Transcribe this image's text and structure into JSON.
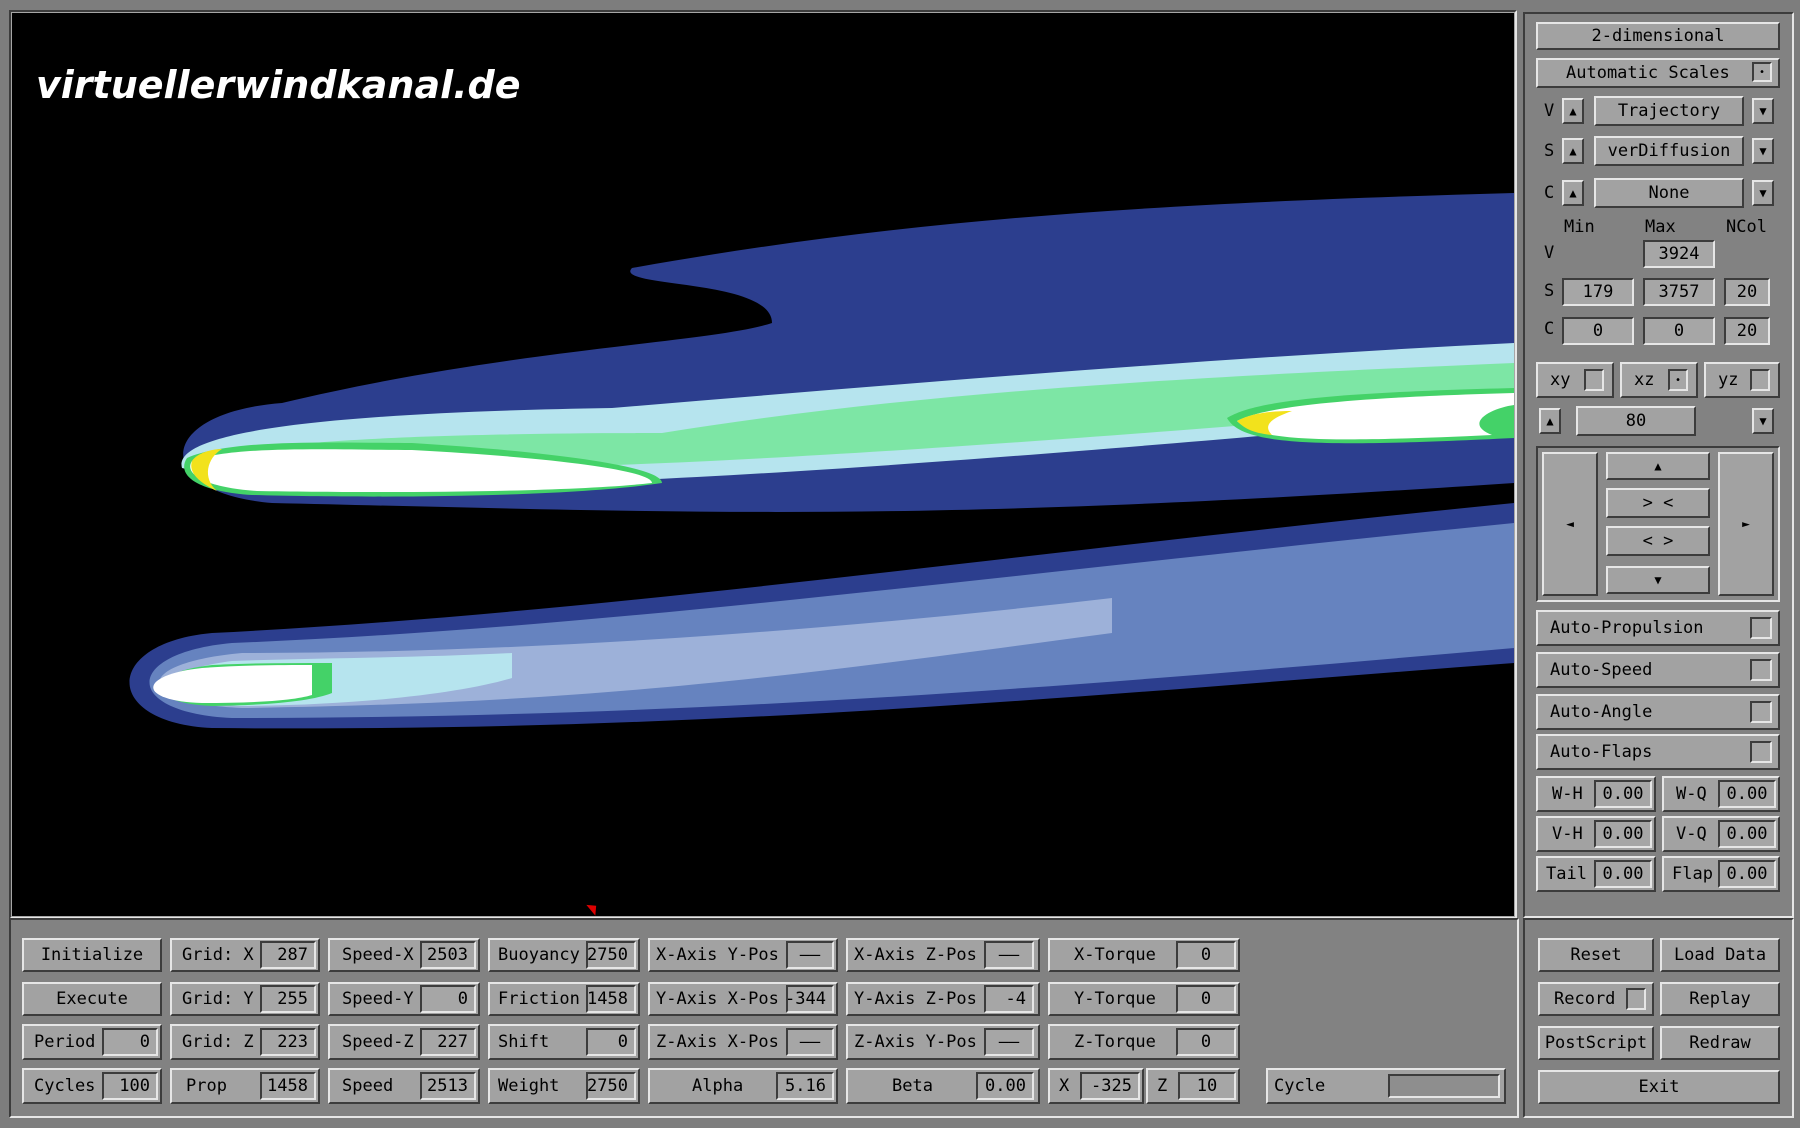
{
  "watermark": "virtuellerwindkanal.de",
  "right_panel": {
    "mode_button": "2-dimensional",
    "auto_scales": "Automatic Scales",
    "v_label": "V",
    "v_value": "Trajectory",
    "s_label": "S",
    "s_value": "verDiffusion",
    "c_label": "C",
    "c_value": "None",
    "col_min": "Min",
    "col_max": "Max",
    "col_ncol": "NCol",
    "v_row_label": "V",
    "v_max": "3924",
    "s_row_label": "S",
    "s_min": "179",
    "s_max": "3757",
    "s_ncol": "20",
    "c_row_label": "C",
    "c_min": "0",
    "c_max": "0",
    "c_ncol": "20",
    "plane_xy": "xy",
    "plane_xz": "xz",
    "plane_yz": "yz",
    "slice_value": "80",
    "nav_up": "▲",
    "nav_in": "> <",
    "nav_out": "< >",
    "nav_down": "▼",
    "nav_left": "◄",
    "nav_right": "►",
    "auto_propulsion": "Auto-Propulsion",
    "auto_speed": "Auto-Speed",
    "auto_angle": "Auto-Angle",
    "auto_flaps": "Auto-Flaps",
    "wh_label": "W-H",
    "wh_value": "0.00",
    "wq_label": "W-Q",
    "wq_value": "0.00",
    "vh_label": "V-H",
    "vh_value": "0.00",
    "vq_label": "V-Q",
    "vq_value": "0.00",
    "tail_label": "Tail",
    "tail_value": "0.00",
    "flap_label": "Flap",
    "flap_value": "0.00"
  },
  "bottom_panel": {
    "initialize": "Initialize",
    "execute": "Execute",
    "period_label": "Period",
    "period_value": "0",
    "cycles_label": "Cycles",
    "cycles_value": "100",
    "gridx_label": "Grid: X",
    "gridx_value": "287",
    "gridy_label": "Grid: Y",
    "gridy_value": "255",
    "gridz_label": "Grid: Z",
    "gridz_value": "223",
    "prop_label": "Prop",
    "prop_value": "1458",
    "speedx_label": "Speed-X",
    "speedx_value": "2503",
    "speedy_label": "Speed-Y",
    "speedy_value": "0",
    "speedz_label": "Speed-Z",
    "speedz_value": "227",
    "speed_label": "Speed",
    "speed_value": "2513",
    "buoyancy_label": "Buoyancy",
    "buoyancy_value": "2750",
    "friction_label": "Friction",
    "friction_value": "1458",
    "shift_label": "Shift",
    "shift_value": "0",
    "weight_label": "Weight",
    "weight_value": "2750",
    "xaxis_ypos_label": "X-Axis Y-Pos",
    "xaxis_ypos_value": "——",
    "yaxis_xpos_label": "Y-Axis X-Pos",
    "yaxis_xpos_value": "-344",
    "zaxis_xpos_label": "Z-Axis X-Pos",
    "zaxis_xpos_value": "——",
    "alpha_label": "Alpha",
    "alpha_value": "5.16",
    "xaxis_zpos_label": "X-Axis Z-Pos",
    "xaxis_zpos_value": "——",
    "yaxis_zpos_label": "Y-Axis Z-Pos",
    "yaxis_zpos_value": "-4",
    "zaxis_ypos_label": "Z-Axis Y-Pos",
    "zaxis_ypos_value": "——",
    "beta_label": "Beta",
    "beta_value": "0.00",
    "xtorque_label": "X-Torque",
    "xtorque_value": "0",
    "ytorque_label": "Y-Torque",
    "ytorque_value": "0",
    "ztorque_label": "Z-Torque",
    "ztorque_value": "0",
    "x_label": "X",
    "x_value": "-325",
    "z_label": "Z",
    "z_value": "10",
    "cycle_label": "Cycle",
    "reset": "Reset",
    "load_data": "Load Data",
    "record": "Record",
    "replay": "Replay",
    "postscript": "PostScript",
    "redraw": "Redraw",
    "exit": "Exit"
  }
}
